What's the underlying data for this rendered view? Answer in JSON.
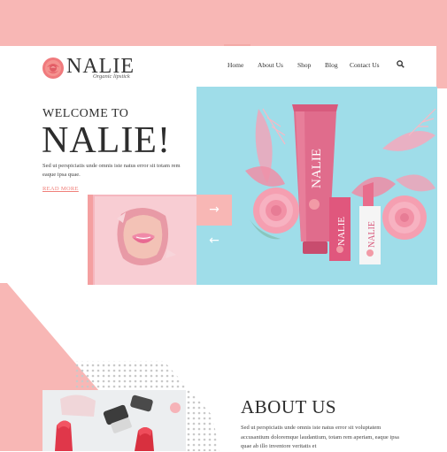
{
  "brand": {
    "name": "NALIE",
    "tagline": "Organic lipstick"
  },
  "nav": {
    "items": [
      "Home",
      "About Us",
      "Shop",
      "Blog",
      "Contact Us"
    ]
  },
  "hero": {
    "welcome": "WELCOME TO",
    "title": "NALIE!",
    "text": "Sed ut perspiciatis unde omnis iste natus error sit totam rem eaque ipsa quae.",
    "read_more": "READ MORE",
    "product_label": "NALIE",
    "product_sub": "Organic lipstick"
  },
  "slider": {
    "next_arrow": "→",
    "prev_arrow": "←"
  },
  "about": {
    "title": "ABOUT US",
    "text": "Sed ut perspiciatis unde omnis iste natus error sit voluptatem accusantium doloremque laudantium, totam rem aperiam, eaque ipsa quae ab illo inventore veritatis et"
  },
  "colors": {
    "pink": "#f8b7b5",
    "accent": "#f0807a",
    "sky": "#9fdde9"
  }
}
